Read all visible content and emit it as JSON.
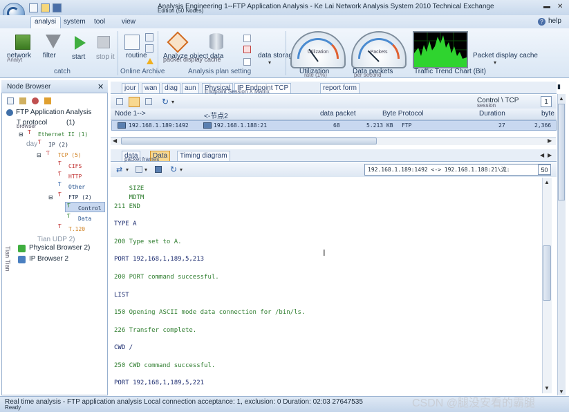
{
  "window": {
    "title": "Analysis Engineering 1--FTP Application Analysis - Ke Lai Network Analysis System 2010 Technical Exchange",
    "title_sub": "Edition (50 Nodes)",
    "help": "help"
  },
  "menu": {
    "tabs": [
      "analysi",
      "system",
      "tool",
      "view"
    ]
  },
  "ribbon": {
    "catch_group": {
      "buttons": [
        "network",
        "filter",
        "start",
        "stop it"
      ],
      "sub_label": "Analyt",
      "label": "catch"
    },
    "online_archive_group": {
      "routine": "routine",
      "label": "Online Archive"
    },
    "analysis_group": {
      "analyze": "Analyze object data",
      "packet_cache": "packet display cache",
      "data_storage": "data storage",
      "label": "Analysis plan setting"
    },
    "gauges": [
      {
        "inner": "Utilization",
        "label": "Utilization",
        "sub": "rate (1%)",
        "value_pct": 30
      },
      {
        "inner": "Packets",
        "label": "Data packets",
        "sub": "per second",
        "value_pct": 25
      }
    ],
    "trend": {
      "label": "Traffic Trend Chart (Bit)"
    },
    "packet_cache_right": "Packet display cache"
  },
  "left_pane": {
    "title": "Node Browser",
    "tree": {
      "root": "FTP Application Analysis",
      "t_protocol": "T protocol",
      "t_protocol_count": "(1)",
      "browser_label": "browser",
      "ethernet": "Ethernet II (1)",
      "day_prefix": "day",
      "ip": "IP (2)",
      "tcp": "TCP (5)",
      "cifs": "CIFS",
      "http": "HTTP",
      "other": "Other",
      "ftp": "FTP (2)",
      "control": "Control",
      "data": "Data",
      "t120": "T.120",
      "udp": "Tian UDP 2)",
      "physical": "Physical Browser 2)",
      "ip_browser": "IP Browser 2",
      "side_text": "Tian Tian"
    }
  },
  "doc_tabs": {
    "top": [
      "jour",
      "wan",
      "diag",
      "aun",
      "Physical",
      "IP Endpoint TCP",
      "report form"
    ],
    "top_sub": "Endpoint Session X Matrix",
    "conversation_label": "Control \\ TCP",
    "conversation_sub": "session",
    "page_num": "1",
    "mid": [
      "data",
      "Data",
      "Timing diagram"
    ],
    "mid_sub": "packet frames"
  },
  "grid": {
    "headers": [
      "Node 1-->",
      "<-节点2",
      "data packet",
      "Byte Protocol",
      "Duration",
      "byte"
    ],
    "row": {
      "node1": "192.168.1.189:1492",
      "node2": "192.168.1.188:21",
      "packets": "68",
      "bytes": "5.213 KB",
      "protocol": "FTP",
      "duration": "27",
      "byte": "2,366"
    }
  },
  "flow": {
    "label": "192.168.1.189:1492 <-> 192.168.1.188:21\\流:",
    "count": "50"
  },
  "decode_lines": [
    {
      "text": "    SIZE",
      "kind": "resp"
    },
    {
      "text": "    MDTM",
      "kind": "resp"
    },
    {
      "text": "211 END",
      "kind": "resp"
    },
    {
      "text": "TYPE A",
      "kind": "cmd"
    },
    {
      "text": "200 Type set to A.",
      "kind": "resp"
    },
    {
      "text": "PORT 192,168,1,189,5,213",
      "kind": "cmd"
    },
    {
      "text": "200 PORT command successful.",
      "kind": "resp"
    },
    {
      "text": "LIST",
      "kind": "cmd"
    },
    {
      "text": "150 Opening ASCII mode data connection for /bin/ls.",
      "kind": "resp"
    },
    {
      "text": "226 Transfer complete.",
      "kind": "resp"
    },
    {
      "text": "CWD /",
      "kind": "cmd"
    },
    {
      "text": "250 CWD command successful.",
      "kind": "resp"
    },
    {
      "text": "PORT 192,168,1,189,5,221",
      "kind": "cmd"
    }
  ],
  "status": {
    "text": "Real time analysis - FTP application analysis Local connection acceptance: 1, exclusion: 0 Duration: 02:03 27647535",
    "ready": "Ready",
    "watermark": "CSDN @腿没安看的霸腿"
  },
  "colors": {
    "accent": "#3f6fa8",
    "cmd": "#1a2a6e",
    "resp": "#2e7d2e",
    "selected_row": "#c8d8f0"
  }
}
